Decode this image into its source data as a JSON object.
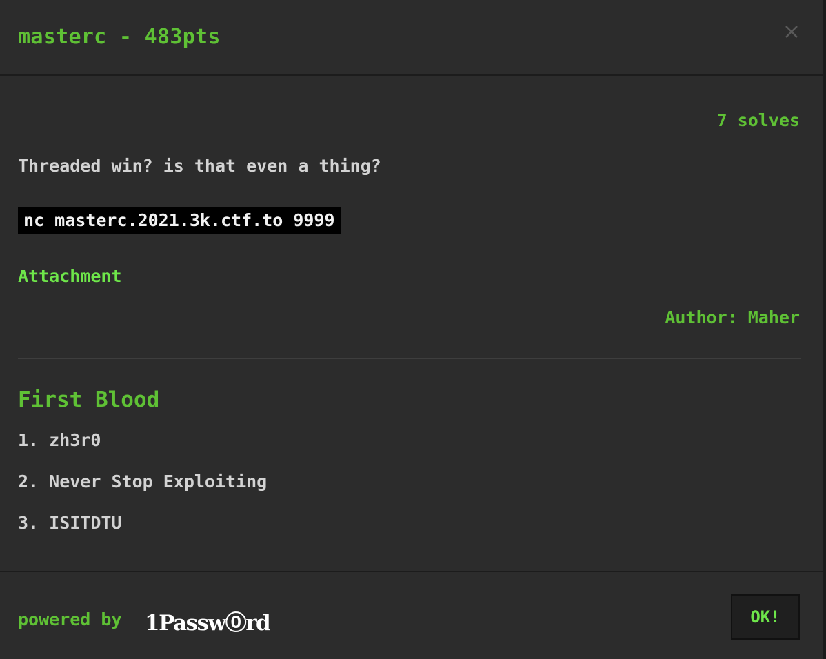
{
  "modal": {
    "title": "masterc - 483pts",
    "solves": "7 solves",
    "description": "Threaded win? is that even a thing?",
    "command": "nc masterc.2021.3k.ctf.to 9999",
    "attachment_label": "Attachment",
    "author": "Author: Maher"
  },
  "first_blood": {
    "heading": "First Blood",
    "entries": [
      "1. zh3r0",
      "2. Never Stop Exploiting",
      "3. ISITDTU"
    ]
  },
  "footer": {
    "powered_by": "powered by",
    "brand": "1Passw⓪rd",
    "ok_label": "OK!"
  },
  "colors": {
    "background": "#2c2c2c",
    "accent": "#5fc135",
    "link": "#6ee64a",
    "text": "#d3d3d3"
  },
  "icons": {
    "close": "close-icon"
  }
}
